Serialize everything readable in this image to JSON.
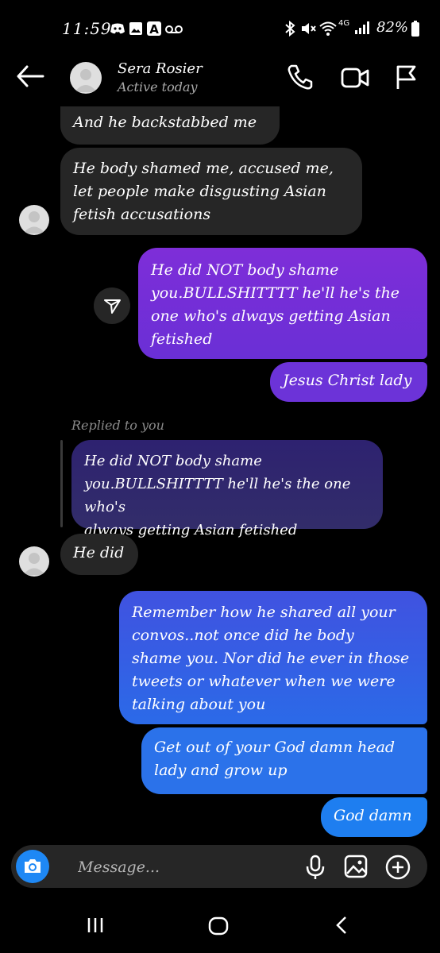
{
  "status_bar": {
    "time": "11:59",
    "battery": "82%",
    "left_icons": [
      "discord-icon",
      "gallery-icon",
      "a-icon",
      "voicemail-icon"
    ],
    "right_icons": [
      "bluetooth-icon",
      "mute-icon",
      "wifi-icon",
      "lte-icon",
      "signal-icon",
      "battery-icon"
    ]
  },
  "header": {
    "contact_name": "Sera Rosier",
    "status": "Active today"
  },
  "messages": [
    {
      "from": "them",
      "text": "And he backstabbed me"
    },
    {
      "from": "them",
      "text": "He body shamed me, accused me,\nlet people make disgusting Asian\nfetish accusations"
    },
    {
      "from": "me",
      "text": "He did NOT body shame\nyou.BULLSHITTTT he'll he's the\none who's always getting Asian\nfetished"
    },
    {
      "from": "me",
      "text": "Jesus Christ lady"
    },
    {
      "from": "them",
      "reply_label": "Replied to you",
      "quoted_text": "He did NOT body shame\nyou.BULLSHITTTT he'll he's the one who's\nalways getting Asian fetished",
      "text": "He did"
    },
    {
      "from": "me",
      "text": "Remember how he shared all your\nconvos..not once did he body\nshame you. Nor did he ever in those\ntweets or whatever when we were\ntalking about you"
    },
    {
      "from": "me",
      "text": "Get out of your God damn head\nlady and grow up"
    },
    {
      "from": "me",
      "text": "God damn"
    }
  ],
  "composer": {
    "placeholder": "Message..."
  },
  "colors": {
    "background": "#000000",
    "incoming_bubble": "#262626",
    "outgoing_purple": "#7e2ed8",
    "outgoing_blue": "#2b6ae8",
    "camera_button": "#1e88f5"
  }
}
